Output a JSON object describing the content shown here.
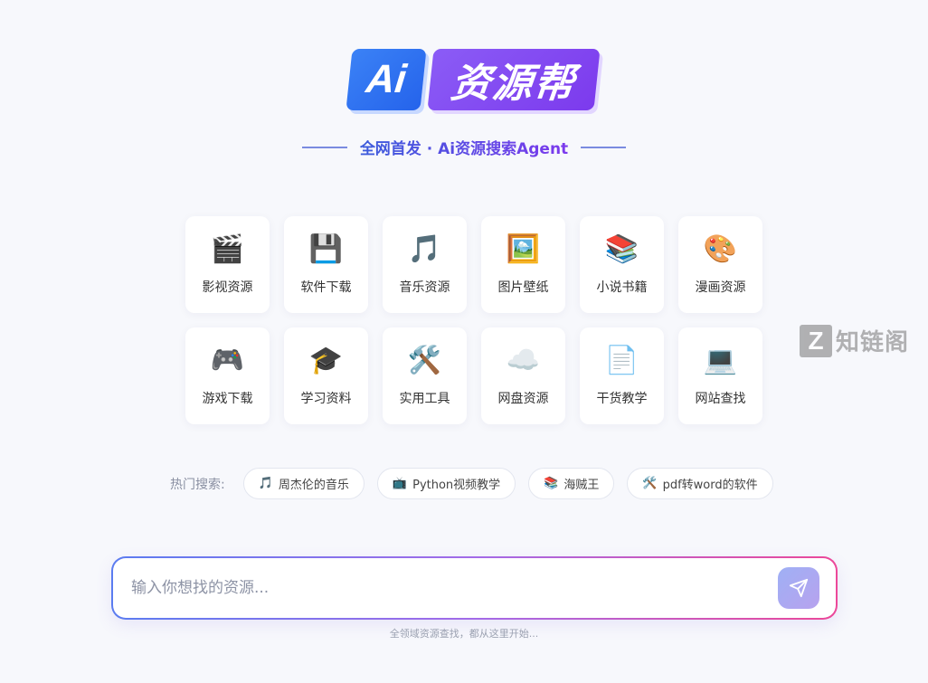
{
  "logo": {
    "ai": "Ai",
    "name": "资源帮"
  },
  "tagline": "全网首发 · Ai资源搜索Agent",
  "categories": [
    {
      "icon": "clapperboard-icon",
      "glyph": "🎬",
      "label": "影视资源"
    },
    {
      "icon": "floppy-disk-icon",
      "glyph": "💾",
      "label": "软件下载"
    },
    {
      "icon": "music-note-icon",
      "glyph": "🎵",
      "label": "音乐资源"
    },
    {
      "icon": "picture-icon",
      "glyph": "🖼️",
      "label": "图片壁纸"
    },
    {
      "icon": "books-icon",
      "glyph": "📚",
      "label": "小说书籍"
    },
    {
      "icon": "palette-icon",
      "glyph": "🎨",
      "label": "漫画资源"
    },
    {
      "icon": "gamepad-icon",
      "glyph": "🎮",
      "label": "游戏下载"
    },
    {
      "icon": "graduation-cap-icon",
      "glyph": "🎓",
      "label": "学习资料"
    },
    {
      "icon": "tools-icon",
      "glyph": "🛠️",
      "label": "实用工具"
    },
    {
      "icon": "cloud-icon",
      "glyph": "☁️",
      "label": "网盘资源"
    },
    {
      "icon": "document-icon",
      "glyph": "📄",
      "label": "干货教学"
    },
    {
      "icon": "laptop-icon",
      "glyph": "💻",
      "label": "网站查找"
    }
  ],
  "hot": {
    "title": "热门搜索:",
    "items": [
      {
        "icon": "music-note-icon",
        "glyph": "🎵",
        "label": "周杰伦的音乐"
      },
      {
        "icon": "tv-icon",
        "glyph": "📺",
        "label": "Python视频教学"
      },
      {
        "icon": "books-icon",
        "glyph": "📚",
        "label": "海贼王"
      },
      {
        "icon": "tools-icon",
        "glyph": "🛠️",
        "label": "pdf转word的软件"
      }
    ]
  },
  "search": {
    "placeholder": "输入你想找的资源...",
    "value": ""
  },
  "hint": "全领域资源查找，都从这里开始...",
  "watermark": {
    "z": "Z",
    "text": "知链阁"
  },
  "colors": {
    "accent_blue": "#3b82f6",
    "accent_purple": "#8b5cf6",
    "accent_pink": "#ec4899"
  }
}
